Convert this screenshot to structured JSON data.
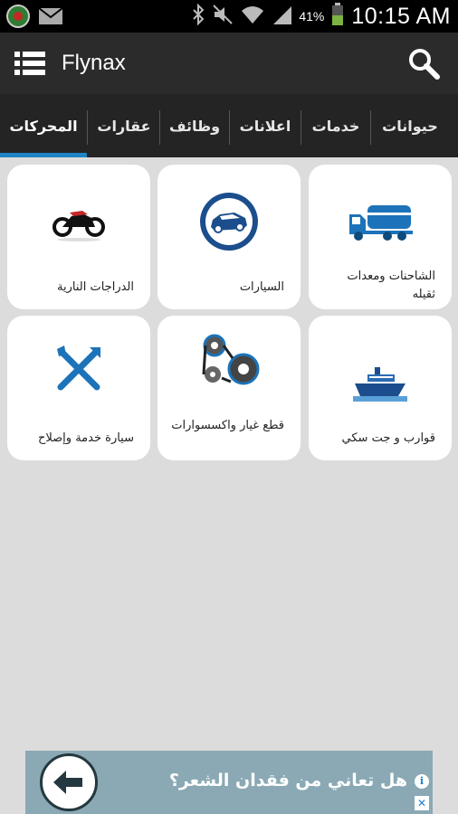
{
  "status_bar": {
    "battery_percent": "41%",
    "time": "10:15 AM",
    "icons": [
      "app-notification-icon",
      "mail-icon",
      "bluetooth-icon",
      "mute-icon",
      "wifi-icon",
      "signal-icon",
      "battery-icon"
    ]
  },
  "app_bar": {
    "title": "Flynax",
    "menu_icon": "menu-icon",
    "search_icon": "search-icon"
  },
  "tabs": [
    {
      "label": "حيوانات",
      "active": false
    },
    {
      "label": "خدمات",
      "active": false
    },
    {
      "label": "اعلانات",
      "active": false
    },
    {
      "label": "وظائف",
      "active": false
    },
    {
      "label": "عقارات",
      "active": false
    },
    {
      "label": "المحركات",
      "active": true
    }
  ],
  "categories": [
    {
      "label": "الشاحنات ومعدات ثقيله",
      "icon": "truck-icon"
    },
    {
      "label": "السيارات",
      "icon": "car-icon"
    },
    {
      "label": "الدراجات النارية",
      "icon": "motorcycle-icon"
    },
    {
      "label": "قوارب و جت سكي",
      "icon": "boat-icon"
    },
    {
      "label": "قطع غيار واكسسوارات",
      "icon": "engine-parts-icon"
    },
    {
      "label": "سيارة خدمة وإصلاح",
      "icon": "tools-icon"
    }
  ],
  "ad": {
    "text": "هل تعاني من فقدان الشعر؟",
    "info_icon": "ad-info-icon",
    "close_icon": "ad-close-icon"
  },
  "colors": {
    "accent": "#1f83c6",
    "app_bar": "#2b2b2b",
    "tab_bar": "#242424",
    "background": "#dcdcdc"
  }
}
